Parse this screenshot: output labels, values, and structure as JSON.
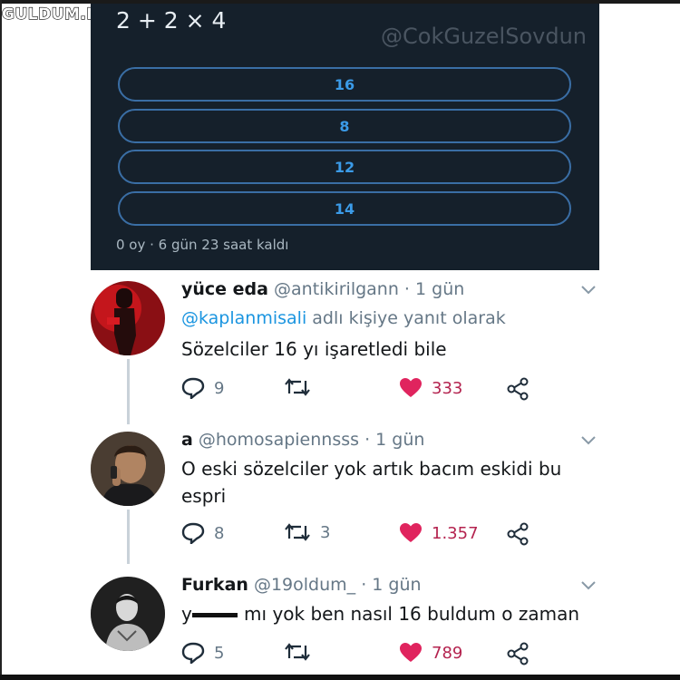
{
  "watermark": {
    "logo_text": "GULDUM.NET"
  },
  "poll": {
    "question": "2 + 2 × 4",
    "watermark_handle": "@CokGuzelSovdun",
    "options": [
      "16",
      "8",
      "12",
      "14"
    ],
    "footer": "0 oy · 6 gün 23 saat kaldı"
  },
  "tweets": [
    {
      "name": "yüce eda",
      "handle": "@antikirilgann · 1 gün",
      "reply_to_mention": "@kaplanmisali",
      "reply_to_suffix": " adlı kişiye yanıt olarak",
      "text": "Sözelciler 16 yı işaretledi bile",
      "replies": "9",
      "retweets": "",
      "likes": "333"
    },
    {
      "name": "a",
      "handle": "@homosapiennsss · 1 gün",
      "text_line1": "O eski sözelciler yok artık bacım eskidi bu",
      "text_line2": "espri",
      "replies": "8",
      "retweets": "3",
      "likes": "1.357"
    },
    {
      "name": "Furkan",
      "handle": "@19oldum_ · 1 gün",
      "text": "y         mı yok ben nasıl 16 buldum o zaman",
      "replies": "5",
      "retweets": "",
      "likes": "789"
    }
  ],
  "colors": {
    "poll_bg": "#15202b",
    "poll_option_border": "#3a6ea5",
    "poll_option_text": "#3b9be8",
    "like_red": "#e0245e",
    "mention_blue": "#1b95e0"
  },
  "icons": [
    "reply-icon",
    "retweet-icon",
    "heart-icon",
    "share-icon",
    "chevron-down-icon"
  ]
}
